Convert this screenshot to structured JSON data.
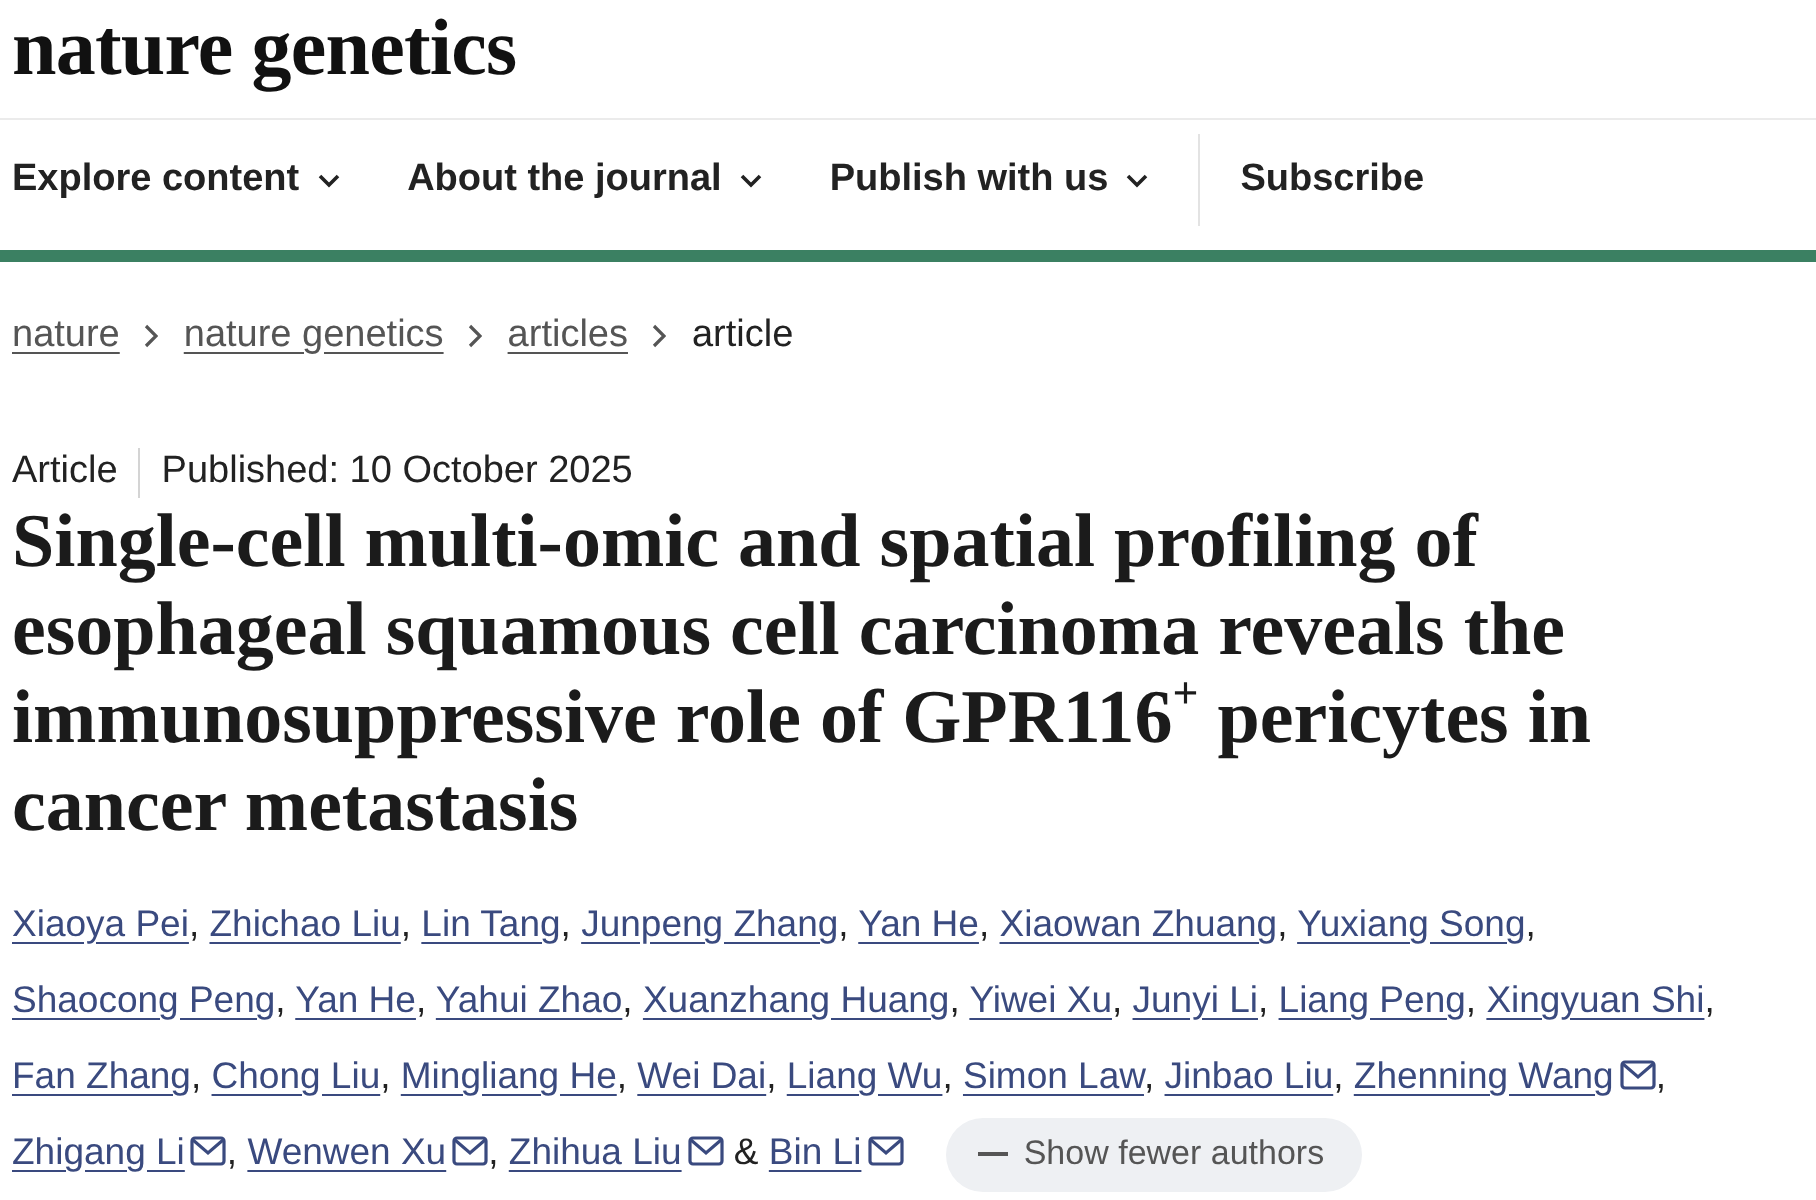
{
  "header": {
    "logo": "nature genetics"
  },
  "nav": {
    "items": [
      {
        "label": "Explore content",
        "kind": "menu"
      },
      {
        "label": "About the journal",
        "kind": "menu"
      },
      {
        "label": "Publish with us",
        "kind": "menu"
      },
      {
        "label": "Subscribe",
        "kind": "link"
      }
    ]
  },
  "breadcrumb": [
    {
      "label": "nature",
      "current": false
    },
    {
      "label": "nature genetics",
      "current": false
    },
    {
      "label": "articles",
      "current": false
    },
    {
      "label": "article",
      "current": true
    }
  ],
  "article": {
    "type": "Article",
    "published": "Published: 10 October 2025",
    "title": "Single-cell multi-omic and spatial profiling of esophageal squamous cell carcinoma reveals the immunosuppressive role of GPR116$^{+}$ pericytes in cancer metastasis",
    "authors": [
      {
        "name": "Xiaoya Pei",
        "corresponding": false,
        "separator": ","
      },
      {
        "name": "Zhichao Liu",
        "corresponding": false,
        "separator": ","
      },
      {
        "name": "Lin Tang",
        "corresponding": false,
        "separator": ","
      },
      {
        "name": "Junpeng Zhang",
        "corresponding": false,
        "separator": ","
      },
      {
        "name": "Yan He",
        "corresponding": false,
        "separator": ","
      },
      {
        "name": "Xiaowan Zhuang",
        "corresponding": false,
        "separator": ","
      },
      {
        "name": "Yuxiang Song",
        "corresponding": false,
        "separator": ","
      },
      {
        "name": "Shaocong Peng",
        "corresponding": false,
        "separator": ","
      },
      {
        "name": "Yan He",
        "corresponding": false,
        "separator": ","
      },
      {
        "name": "Yahui Zhao",
        "corresponding": false,
        "separator": ","
      },
      {
        "name": "Xuanzhang Huang",
        "corresponding": false,
        "separator": ","
      },
      {
        "name": "Yiwei Xu",
        "corresponding": false,
        "separator": ","
      },
      {
        "name": "Junyi Li",
        "corresponding": false,
        "separator": ","
      },
      {
        "name": "Liang Peng",
        "corresponding": false,
        "separator": ","
      },
      {
        "name": "Xingyuan Shi",
        "corresponding": false,
        "separator": ","
      },
      {
        "name": "Fan Zhang",
        "corresponding": false,
        "separator": ","
      },
      {
        "name": "Chong Liu",
        "corresponding": false,
        "separator": ","
      },
      {
        "name": "Mingliang He",
        "corresponding": false,
        "separator": ","
      },
      {
        "name": "Wei Dai",
        "corresponding": false,
        "separator": ","
      },
      {
        "name": "Liang Wu",
        "corresponding": false,
        "separator": ","
      },
      {
        "name": "Simon Law",
        "corresponding": false,
        "separator": ","
      },
      {
        "name": "Jinbao Liu",
        "corresponding": false,
        "separator": ","
      },
      {
        "name": "Zhenning Wang",
        "corresponding": true,
        "separator": ","
      },
      {
        "name": "Zhigang Li",
        "corresponding": true,
        "separator": ","
      },
      {
        "name": "Wenwen Xu",
        "corresponding": true,
        "separator": ","
      },
      {
        "name": "Zhihua Liu",
        "corresponding": true,
        "separator": " &"
      },
      {
        "name": "Bin Li",
        "corresponding": true
      }
    ],
    "authors_toggle": "Show fewer authors"
  }
}
